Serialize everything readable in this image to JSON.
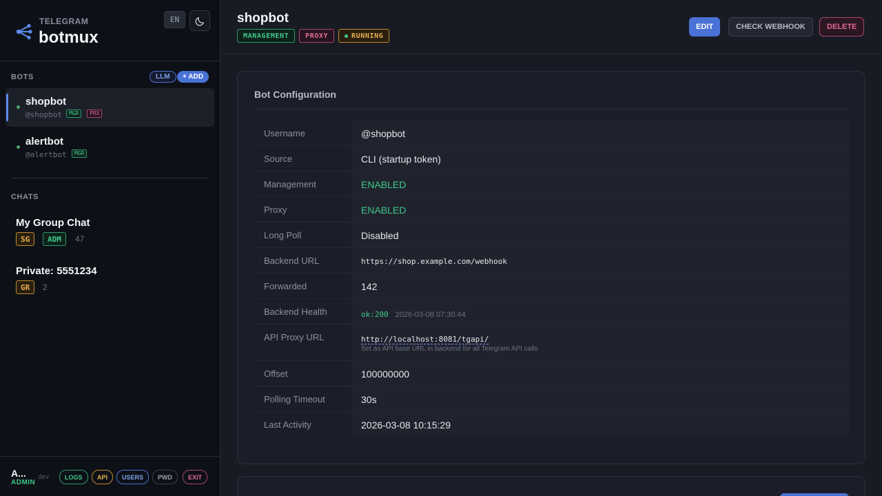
{
  "brand": {
    "sup": "TELEGRAM",
    "name": "botmux",
    "lang": "EN"
  },
  "bots_section": {
    "label": "BOTS",
    "llm_label": "LLM",
    "add_label": "+ ADD",
    "items": [
      {
        "name": "shopbot",
        "handle": "@shopbot",
        "tags": [
          "MGR",
          "PRX"
        ],
        "status": "online"
      },
      {
        "name": "alertbot",
        "handle": "@alertbot",
        "tags": [
          "MGR"
        ],
        "status": "online"
      }
    ]
  },
  "chats_section": {
    "label": "CHATS",
    "items": [
      {
        "name": "My Group Chat",
        "chips": [
          "SG",
          "ADM"
        ],
        "count": "47"
      },
      {
        "name": "Private: 5551234",
        "chips": [
          "GR"
        ],
        "count": "2"
      }
    ]
  },
  "footer": {
    "user": "A...",
    "role": "ADMIN",
    "env": "dev",
    "buttons": {
      "logs": "LOGS",
      "api": "API",
      "users": "USERS",
      "pwd": "PWD",
      "exit": "EXIT"
    }
  },
  "header": {
    "title": "shopbot",
    "tags": {
      "management": "MANAGEMENT",
      "proxy": "PROXY",
      "running": "RUNNING"
    },
    "actions": {
      "edit": "EDIT",
      "check_webhook": "CHECK WEBHOOK",
      "delete": "DELETE"
    }
  },
  "config": {
    "title": "Bot Configuration",
    "rows": {
      "username": {
        "label": "Username",
        "value": "@shopbot"
      },
      "source": {
        "label": "Source",
        "value": "CLI (startup token)"
      },
      "management": {
        "label": "Management",
        "value": "ENABLED"
      },
      "proxy": {
        "label": "Proxy",
        "value": "ENABLED"
      },
      "long_poll": {
        "label": "Long Poll",
        "value": "Disabled"
      },
      "backend_url": {
        "label": "Backend URL",
        "value": "https://shop.example.com/webhook"
      },
      "forwarded": {
        "label": "Forwarded",
        "value": "142"
      },
      "backend_health": {
        "label": "Backend Health",
        "status": "ok:200",
        "timestamp": "2026-03-08 07:30:44"
      },
      "api_proxy_url": {
        "label": "API Proxy URL",
        "value": "http://localhost:8081/tgapi/",
        "help": "Set as API base URL in backend for all Telegram API calls"
      },
      "offset": {
        "label": "Offset",
        "value": "100000000"
      },
      "polling_timeout": {
        "label": "Polling Timeout",
        "value": "30s"
      },
      "last_activity": {
        "label": "Last Activity",
        "value": "2026-03-08 10:15:29"
      }
    }
  },
  "colors": {
    "accent": "#4a72d6",
    "success": "#3fc98a",
    "warning": "#e8b04f",
    "danger": "#e06a96"
  }
}
